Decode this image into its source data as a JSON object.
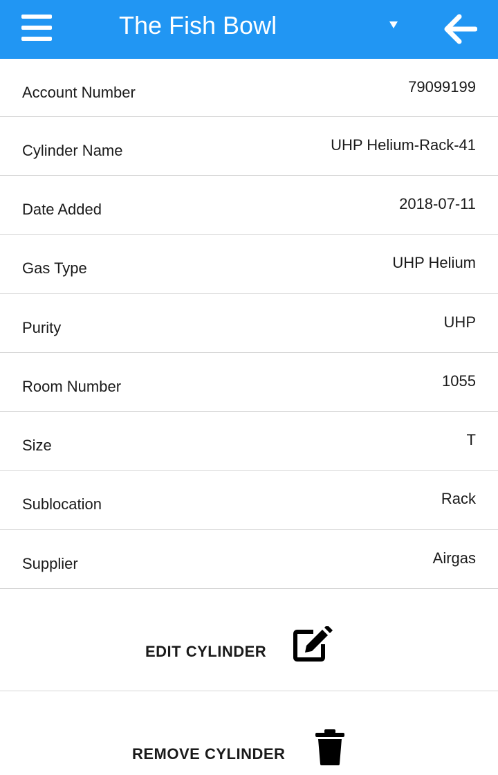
{
  "header": {
    "title": "The Fish Bowl",
    "background_color": "#2196f3",
    "menu_icon": "hamburger-menu-icon",
    "dropdown_icon": "caret-down-icon",
    "back_icon": "arrow-left-icon"
  },
  "details": [
    {
      "label": "Account Number",
      "value": "79099199"
    },
    {
      "label": "Cylinder Name",
      "value": "UHP Helium-Rack-41"
    },
    {
      "label": "Date Added",
      "value": "2018-07-11"
    },
    {
      "label": "Gas Type",
      "value": "UHP Helium"
    },
    {
      "label": "Purity",
      "value": "UHP"
    },
    {
      "label": "Room Number",
      "value": "1055"
    },
    {
      "label": "Size",
      "value": "T"
    },
    {
      "label": "Sublocation",
      "value": "Rack"
    },
    {
      "label": "Supplier",
      "value": "Airgas"
    }
  ],
  "actions": {
    "edit_label": "EDIT CYLINDER",
    "edit_icon": "edit-pencil-icon",
    "remove_label": "REMOVE CYLINDER",
    "remove_icon": "trash-icon"
  }
}
